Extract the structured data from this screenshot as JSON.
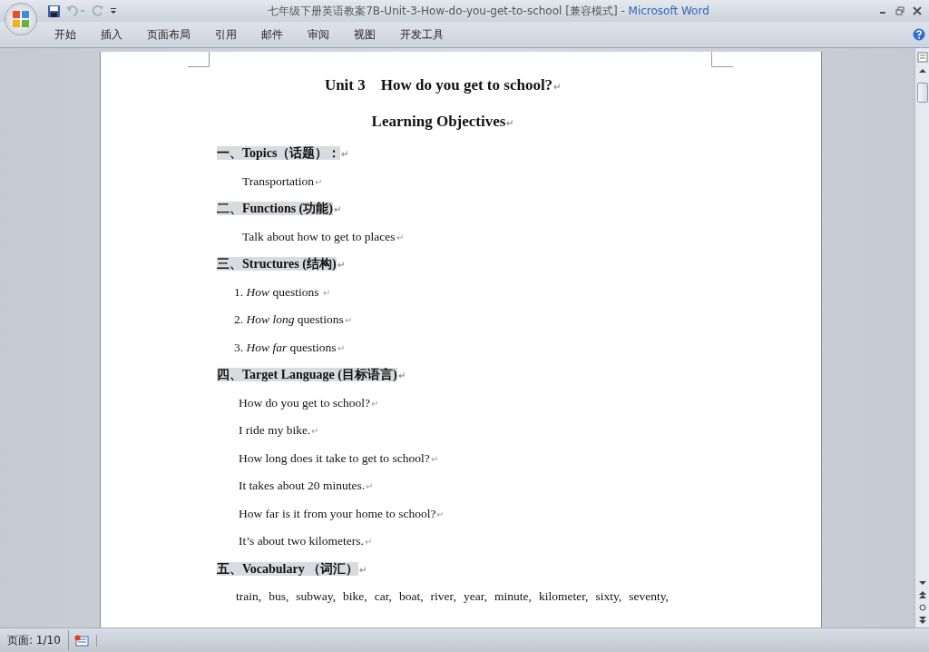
{
  "window": {
    "title": "七年级下册英语教案7B-Unit-3-How-do-you-get-to-school [兼容模式]",
    "separator": "-",
    "app": "Microsoft Word"
  },
  "ribbon_tabs": [
    {
      "label": "开始"
    },
    {
      "label": "插入"
    },
    {
      "label": "页面布局"
    },
    {
      "label": "引用"
    },
    {
      "label": "邮件"
    },
    {
      "label": "审阅"
    },
    {
      "label": "视图"
    },
    {
      "label": "开发工具"
    }
  ],
  "document": {
    "paragraphs": [
      {
        "kind": "title",
        "text": "Unit 3　How do you get to school?",
        "mark": "↵"
      },
      {
        "kind": "title",
        "text": "Learning Objectives",
        "mark": "↵"
      },
      {
        "kind": "heading",
        "text": "一、Topics（话题）：",
        "mark": "↵"
      },
      {
        "kind": "body",
        "text": "Transportation",
        "mark": "↵"
      },
      {
        "kind": "heading",
        "text": "二、Functions (功能)",
        "mark": "↵"
      },
      {
        "kind": "body",
        "text": "Talk about how to get to places",
        "mark": "↵"
      },
      {
        "kind": "heading",
        "text": "三、Structures (结构)",
        "mark": "↵"
      },
      {
        "kind": "list",
        "text": "1. *How* questions  ",
        "mark": "↵"
      },
      {
        "kind": "list",
        "text": "2. *How long* questions",
        "mark": "↵"
      },
      {
        "kind": "list",
        "text": "3. *How far* questions",
        "mark": "↵"
      },
      {
        "kind": "heading",
        "text": "四、Target Language (目标语言)",
        "mark": "↵"
      },
      {
        "kind": "sentence",
        "text": "How do you get to school?",
        "mark": "↵"
      },
      {
        "kind": "sentence",
        "text": "I ride my bike.",
        "mark": "↵"
      },
      {
        "kind": "sentence",
        "text": "How long does it take to get to school?",
        "mark": "↵"
      },
      {
        "kind": "sentence",
        "text": "It takes about 20 minutes.",
        "mark": "↵"
      },
      {
        "kind": "sentence",
        "text": "How far is it from your home to school?",
        "mark": "↵"
      },
      {
        "kind": "sentence",
        "text": "It’s about two kilometers.",
        "mark": "↵"
      },
      {
        "kind": "heading",
        "text": "五、Vocabulary （词汇）",
        "mark": "↵"
      },
      {
        "kind": "vocab",
        "text": "train, bus, subway, bike, car, boat, river, year, minute, kilometer, sixty, seventy,"
      }
    ]
  },
  "status_bar": {
    "page": "页面: 1/10"
  }
}
